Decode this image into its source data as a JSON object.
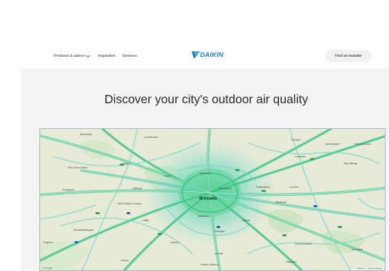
{
  "header": {
    "nav": [
      {
        "label": "Products & advice",
        "has_dropdown": true,
        "icon": "chevron-down-icon"
      },
      {
        "label": "Inspiration",
        "has_dropdown": false
      },
      {
        "label": "Services",
        "has_dropdown": false
      }
    ],
    "logo": {
      "text": "DAIKIN",
      "icon": "daikin-triangle-logo",
      "color": "#1b7fcf"
    },
    "cta_label": "Find an installer"
  },
  "main": {
    "title": "Discover your city's outdoor air quality",
    "map": {
      "city": "Brussels",
      "places": [
        "Mechelen",
        "Londerzeel",
        "Tremelo",
        "Keerbergen",
        "Schoonhoven",
        "Lubbeek",
        "Sint-Joris-Weert",
        "Tielt-Winge",
        "Zottegem",
        "Aalst",
        "Asse",
        "Vilvoorde",
        "Zaventem",
        "Kortenberg",
        "Leuven",
        "Bierbeek",
        "Dilbeek",
        "Sint-Pieters-Leeuw",
        "Halle",
        "Waterloo",
        "Wavre",
        "Overijse",
        "Geraardsbergen",
        "Enghien",
        "Ninove",
        "Lennik",
        "Tubize",
        "Braine-l'Alleud",
        "Ottignies",
        "Grez-Doiceau",
        "Jodoigne"
      ],
      "attribution": "© Mapbox © OpenStreetMap",
      "google_badge": "© Google"
    }
  }
}
